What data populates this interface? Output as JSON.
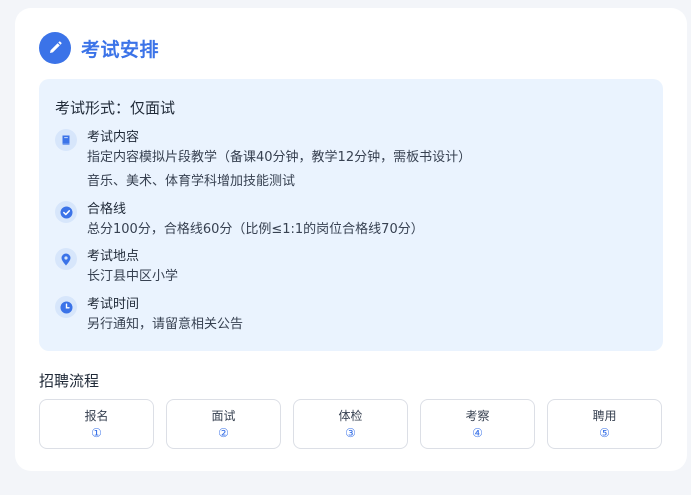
{
  "header": {
    "title": "考试安排",
    "icon": "pencil-icon"
  },
  "exam": {
    "format": "考试形式：仅面试",
    "items": [
      {
        "icon": "book-icon",
        "label": "考试内容",
        "text": "指定内容模拟片段教学（备课40分钟，教学12分钟，需板书设计）",
        "text2": "音乐、美术、体育学科增加技能测试"
      },
      {
        "icon": "check-circle-icon",
        "label": "合格线",
        "text": "总分100分，合格线60分（比例≤1:1的岗位合格线70分）"
      },
      {
        "icon": "location-pin-icon",
        "label": "考试地点",
        "text": "长汀县中区小学"
      },
      {
        "icon": "clock-icon",
        "label": "考试时间",
        "text": "另行通知，请留意相关公告"
      }
    ]
  },
  "process": {
    "title": "招聘流程",
    "steps": [
      {
        "label": "报名",
        "num": "①"
      },
      {
        "label": "面试",
        "num": "②"
      },
      {
        "label": "体检",
        "num": "③"
      },
      {
        "label": "考察",
        "num": "④"
      },
      {
        "label": "聘用",
        "num": "⑤"
      }
    ]
  },
  "colors": {
    "accent": "#3b73e8",
    "info_bg": "#eaf3fe",
    "icon_bg": "#d7e6fb",
    "page_bg": "#f3f5f9"
  }
}
